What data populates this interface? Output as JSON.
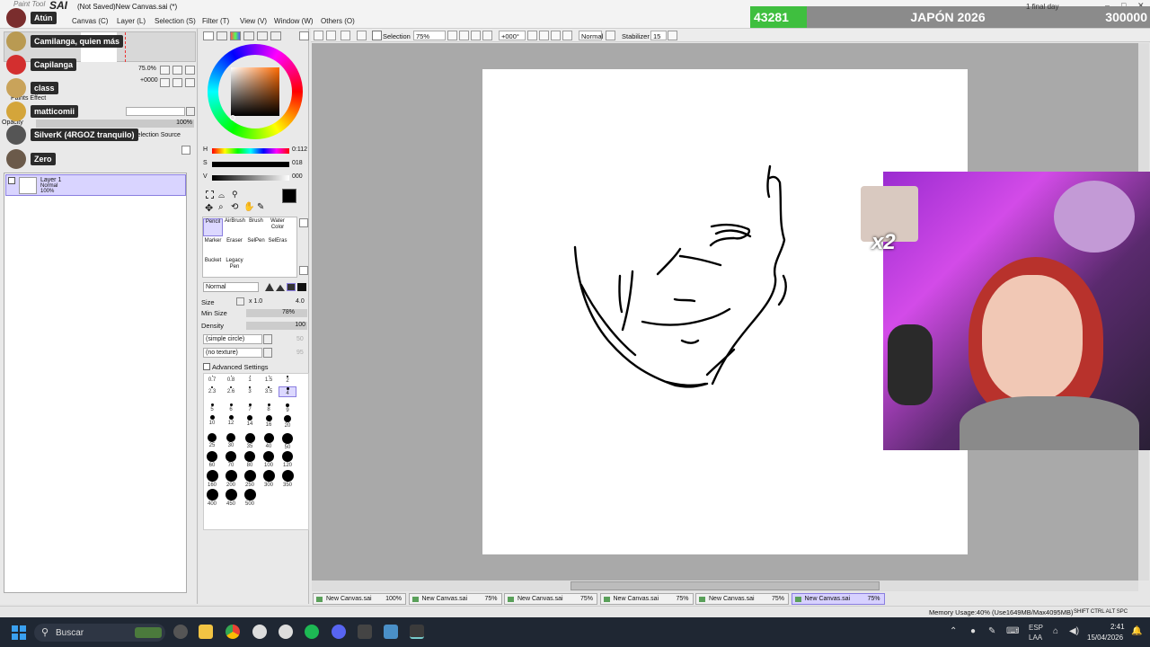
{
  "window": {
    "logo_caption": "Paint Tool",
    "app_name": "SAI",
    "title": "(Not Saved)New Canvas.sai (*)",
    "controls": [
      "–",
      "□",
      "✕"
    ]
  },
  "menu": [
    "Canvas (C)",
    "Layer (L)",
    "Selection (S)",
    "Filter (T)",
    "View (V)",
    "Window (W)",
    "Others (O)"
  ],
  "score_overlay": {
    "count": "43281",
    "title": "JAPÓN 2026",
    "goal": "300000",
    "top_text": "1 final day"
  },
  "toolbar": {
    "selection_label": "Selection",
    "zoom": "75%",
    "rotation": "+000°",
    "blend": "Normal",
    "stabilizer_label": "Stabilizer",
    "stabilizer_value": "15"
  },
  "navigator": {
    "zoom_value": "75.0%",
    "angle_value": "+0000"
  },
  "layer_panel": {
    "paint_effects_label": "Paints Effect",
    "opacity_label": "Opacity",
    "opacity_value": "100%",
    "selection_source_label": "Selection Source",
    "layer": {
      "name": "Layer 1",
      "mode": "Normal",
      "opacity": "100%"
    }
  },
  "chat_viewers": [
    {
      "name": "Atún"
    },
    {
      "name": "Camilanga, quien más"
    },
    {
      "name": "Capilanga"
    },
    {
      "name": "class"
    },
    {
      "name": "matticomii"
    },
    {
      "name": "SilverK (4RGOZ tranquilo)"
    },
    {
      "name": "Zero"
    }
  ],
  "color": {
    "h_label": "H",
    "h_value": "0:112",
    "s_label": "S",
    "s_value": "018",
    "v_label": "V",
    "v_value": "000",
    "primary": "#000000"
  },
  "tools": [
    {
      "label": "Pencil",
      "selected": true
    },
    {
      "label": "AirBrush",
      "selected": false
    },
    {
      "label": "Brush",
      "selected": false
    },
    {
      "label": "Water Color",
      "selected": false
    },
    {
      "label": "Marker",
      "selected": false
    },
    {
      "label": "Eraser",
      "selected": false
    },
    {
      "label": "SelPen",
      "selected": false
    },
    {
      "label": "SelEras",
      "selected": false
    },
    {
      "label": "Bucket",
      "selected": false
    },
    {
      "label": "Legacy Pen",
      "selected": false
    }
  ],
  "brush": {
    "mode": "Normal",
    "size_label": "Size",
    "size_mult": "x 1.0",
    "size_value": "4.0",
    "minsize_label": "Min Size",
    "minsize_value": "78%",
    "density_label": "Density",
    "density_value": "100",
    "shape": "(simple circle)",
    "shape_value": "50",
    "texture": "(no texture)",
    "texture_value": "95",
    "advanced_label": "Advanced Settings"
  },
  "brush_sizes": [
    "0.7",
    "0.8",
    "1",
    "1.5",
    "2",
    "2.3",
    "2.6",
    "3",
    "3.5",
    "4",
    "5",
    "6",
    "7",
    "8",
    "9",
    "10",
    "12",
    "14",
    "16",
    "20",
    "25",
    "30",
    "35",
    "40",
    "50",
    "60",
    "70",
    "80",
    "100",
    "120",
    "160",
    "200",
    "250",
    "300",
    "350",
    "400",
    "450",
    "500"
  ],
  "doc_tabs": [
    {
      "name": "New Canvas.sai",
      "zoom": "100%",
      "active": false
    },
    {
      "name": "New Canvas.sai",
      "zoom": "75%",
      "active": false
    },
    {
      "name": "New Canvas.sai",
      "zoom": "75%",
      "active": false
    },
    {
      "name": "New Canvas.sai",
      "zoom": "75%",
      "active": false
    },
    {
      "name": "New Canvas.sai",
      "zoom": "75%",
      "active": false
    },
    {
      "name": "New Canvas.sai",
      "zoom": "75%",
      "active": true
    }
  ],
  "status": {
    "memory": "Memory Usage:40% (Use1649MB/Max4095MB)",
    "indicators": "SHIFT CTRL ALT SPC"
  },
  "taskbar": {
    "search_placeholder": "Buscar",
    "lang_top": "ESP",
    "lang_bottom": "LAA",
    "time": "2:41",
    "date": "15/04/2026"
  },
  "overlay_badge": "x2"
}
